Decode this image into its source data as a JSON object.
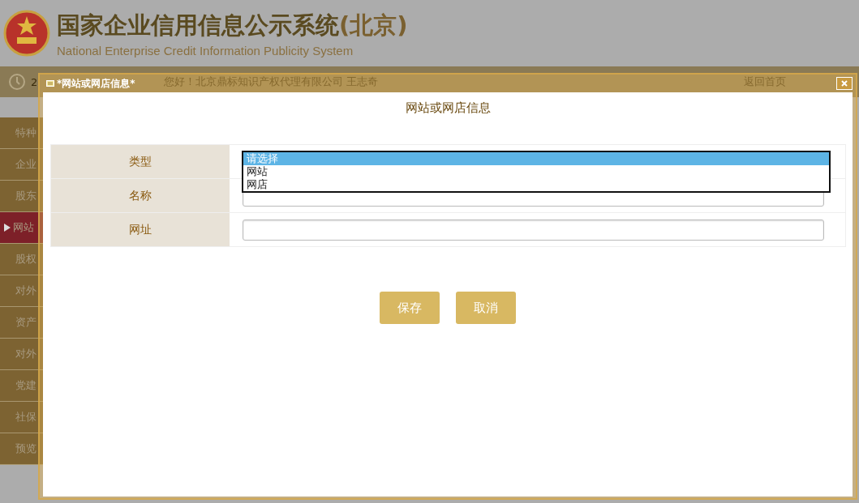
{
  "header": {
    "title": "国家企业信用信息公示系统",
    "title_suffix": "(北京)",
    "subtitle": "National Enterprise Credit Information Publicity System"
  },
  "topbar": {
    "date_fragment": "2",
    "greeting": "您好！北京鼎标知识产权代理有限公司  王志奇",
    "home_link": "返回首页"
  },
  "sidebar": {
    "items": [
      {
        "label": "特种",
        "selected": false
      },
      {
        "label": "企业",
        "selected": false
      },
      {
        "label": "股东",
        "selected": false
      },
      {
        "label": "网站",
        "selected": true
      },
      {
        "label": "股权",
        "selected": false
      },
      {
        "label": "对外",
        "selected": false
      },
      {
        "label": "资产",
        "selected": false
      },
      {
        "label": "对外",
        "selected": false
      },
      {
        "label": "党建",
        "selected": false
      },
      {
        "label": "社保",
        "selected": false
      },
      {
        "label": "预览",
        "selected": false
      }
    ]
  },
  "dialog": {
    "title": "*网站或网店信息*",
    "heading": "网站或网店信息",
    "fields": [
      {
        "label": "类型",
        "kind": "select",
        "open": true,
        "options": [
          {
            "label": "请选择",
            "selected": true
          },
          {
            "label": "网站",
            "selected": false
          },
          {
            "label": "网店",
            "selected": false
          }
        ]
      },
      {
        "label": "名称",
        "kind": "text"
      },
      {
        "label": "网址",
        "kind": "text"
      }
    ],
    "buttons": [
      "保存",
      "取消"
    ]
  }
}
